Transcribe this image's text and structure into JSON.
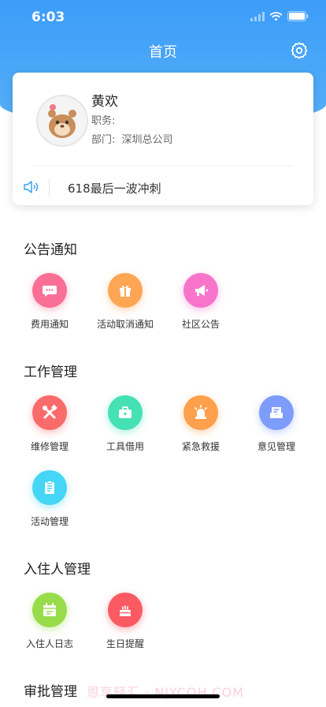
{
  "status_bar": {
    "time": "6:03"
  },
  "nav": {
    "title": "首页"
  },
  "profile": {
    "name": "黄欢",
    "role_label": "职务:",
    "department_label": "部门:",
    "department_value": "深圳总公司"
  },
  "announcement": {
    "text": "618最后一波冲刺"
  },
  "sections": {
    "notices": {
      "title": "公告通知",
      "items": [
        {
          "label": "费用通知",
          "icon": "chat-icon",
          "color": "#fb6f96"
        },
        {
          "label": "活动取消通知",
          "icon": "gift-icon",
          "color": "#ffa655"
        },
        {
          "label": "社区公告",
          "icon": "megaphone-icon",
          "color": "#f874cb"
        }
      ]
    },
    "work": {
      "title": "工作管理",
      "items": [
        {
          "label": "维修管理",
          "icon": "tools-icon",
          "color": "#fb6b6b"
        },
        {
          "label": "工具借用",
          "icon": "toolbox-icon",
          "color": "#45e0b3"
        },
        {
          "label": "紧急救援",
          "icon": "siren-icon",
          "color": "#ffa04d"
        },
        {
          "label": "意见管理",
          "icon": "mailbox-icon",
          "color": "#7d9cfb"
        },
        {
          "label": "活动管理",
          "icon": "clipboard-icon",
          "color": "#45d5f5"
        }
      ]
    },
    "residents": {
      "title": "入住人管理",
      "items": [
        {
          "label": "入住人日志",
          "icon": "calendar-icon",
          "color": "#98dc4a"
        },
        {
          "label": "生日提醒",
          "icon": "cake-icon",
          "color": "#fb5a62"
        }
      ]
    },
    "approval": {
      "title": "审批管理"
    }
  },
  "watermark": "恩享轻汇 · NJYCOH.COM"
}
